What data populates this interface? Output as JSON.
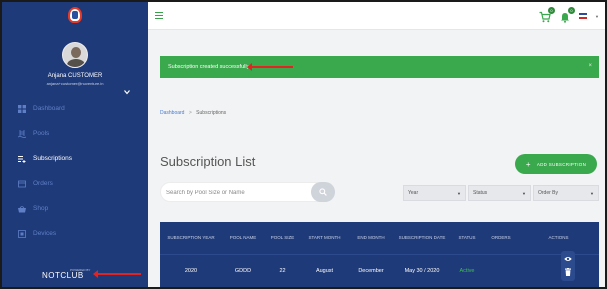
{
  "sidebar": {
    "user_name": "Anjana CUSTOMER",
    "user_email": "anjana+customer@nuventure.in",
    "items": [
      {
        "label": "Dashboard",
        "icon": "grid-icon"
      },
      {
        "label": "Pools",
        "icon": "pool-icon"
      },
      {
        "label": "Subscriptions",
        "icon": "list-icon"
      },
      {
        "label": "Orders",
        "icon": "orders-icon"
      },
      {
        "label": "Shop",
        "icon": "shop-icon"
      },
      {
        "label": "Devices",
        "icon": "devices-icon"
      }
    ],
    "active_item": "Subscriptions",
    "brand_small": "POWERED BY",
    "brand": "NOTCLUB"
  },
  "topbar": {
    "cart_badge": "0",
    "bell_badge": "0"
  },
  "alert": {
    "message": "Subscription created successfully",
    "close": "×"
  },
  "breadcrumb": {
    "home": "Dashboard",
    "separator": ">",
    "current": "Subscriptions"
  },
  "page": {
    "title": "Subscription List",
    "add_button": "ADD SUBSCRIPTION"
  },
  "filters": {
    "search_placeholder": "Search by Pool Size or Name",
    "year": "Year",
    "status": "Status",
    "order_by": "Order By"
  },
  "table": {
    "headers": [
      "SUBSCRIPTION YEAR",
      "POOL NAME",
      "POOL SIZE",
      "START MONTH",
      "END MONTH",
      "SUBSCRIPTION DATE",
      "STATUS",
      "ORDERS",
      "ACTIONS"
    ],
    "rows": [
      {
        "year": "2020",
        "pool_name": "GDDD",
        "pool_size": "22",
        "start_month": "August",
        "end_month": "December",
        "date": "May 30 / 2020",
        "status": "Active",
        "orders": ""
      }
    ]
  },
  "colors": {
    "sidebar_bg": "#1f3a78",
    "accent_green": "#3aa84d",
    "annotation_red": "#e02424"
  }
}
